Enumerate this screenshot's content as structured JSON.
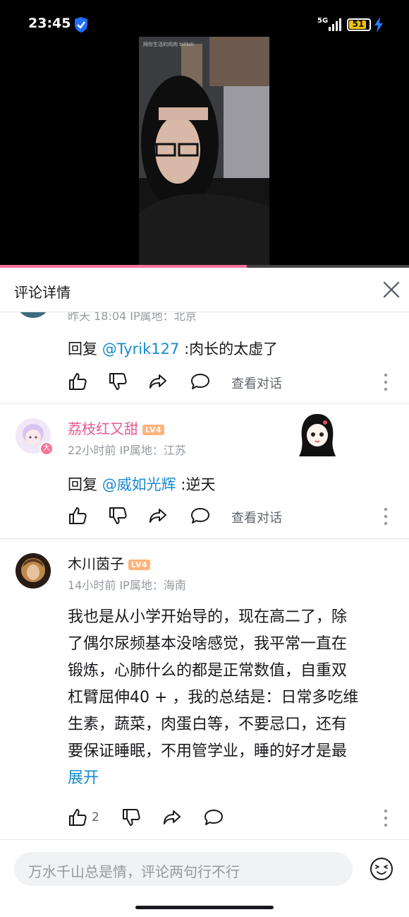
{
  "status_bar": {
    "time": "23:45",
    "network": "5G",
    "battery": "51"
  },
  "video": {
    "watermark": "网你生活的鸡肉 bilibili"
  },
  "header": {
    "title": "评论详情"
  },
  "comments": [
    {
      "meta": "昨天 18:04  IP属地：北京",
      "reply_prefix": "回复 ",
      "mention": "@Tyrik127",
      "reply_text": " :肉长的太虚了",
      "view_conversation": "查看对话"
    },
    {
      "username": "荔枝红又甜",
      "level": "LV4",
      "meta": "22小时前  IP属地：江苏",
      "reply_prefix": "回复 ",
      "mention": "@威如光辉",
      "reply_text": " :逆天",
      "view_conversation": "查看对话"
    },
    {
      "username": "木川茵子",
      "level": "LV4",
      "meta": "14小时前  IP属地：海南",
      "lines": [
        "我也是从小学开始导的，现在高二了，除",
        "了偶尔尿频基本没啥感觉，我平常一直在",
        "锻炼，心肺什么的都是正常数值，自重双",
        "杠臂屈伸40 + ，我的总结是：日常多吃维",
        "生素，蔬菜，肉蛋白等，不要忌口，还有",
        "要保证睡眠，不用管学业，睡的好才是最"
      ],
      "expand": "展开",
      "like_count": "2"
    }
  ],
  "input": {
    "placeholder": "万水千山总是情，评论两句行不行"
  },
  "colors": {
    "accent_pink": "#fb7299",
    "link_blue": "#178bcf",
    "username_pink": "#e75a94",
    "level_orange": "#ffb37c"
  },
  "icons": [
    "shield-icon",
    "signal-icon",
    "battery-icon",
    "charging-icon",
    "close-icon",
    "like-icon",
    "dislike-icon",
    "share-icon",
    "comment-icon",
    "more-icon",
    "emoji-icon"
  ]
}
